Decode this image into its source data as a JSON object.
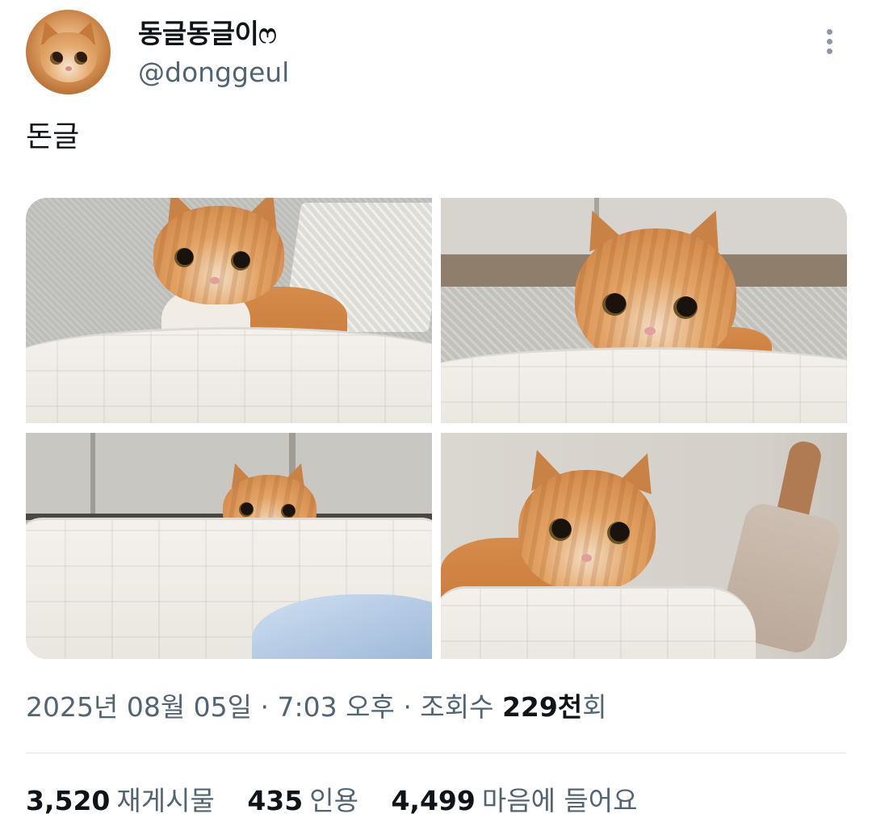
{
  "user": {
    "display_name": "동글동글이ෆ",
    "handle": "@donggeul"
  },
  "tweet": {
    "text": "돈글",
    "media_count": 4
  },
  "meta": {
    "date": "2025년 08월 05일",
    "separator": "·",
    "time": "7:03 오후",
    "views_label": "조회수",
    "views_count": "229천",
    "views_suffix": "회"
  },
  "stats": {
    "reposts_count": "3,520",
    "reposts_label": "재게시물",
    "quotes_count": "435",
    "quotes_label": "인용",
    "likes_count": "4,499",
    "likes_label": "마음에 들어요"
  },
  "icons": {
    "more": "more-vertical-icon"
  },
  "colors": {
    "text_primary": "#0f1419",
    "text_secondary": "#536471",
    "divider": "#e1e6ea"
  }
}
